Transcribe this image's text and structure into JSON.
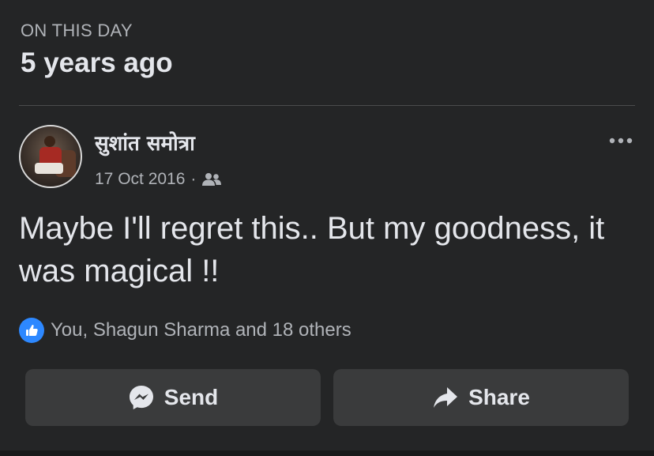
{
  "memory": {
    "label": "ON THIS DAY",
    "title": "5 years ago"
  },
  "post": {
    "author": "सुशांत समोत्रा",
    "date": "17 Oct 2016",
    "separator": "·",
    "audience_icon": "friends-icon",
    "more_icon": "more-options-icon",
    "text": "Maybe I'll regret this.. But my goodness, it was magical !!"
  },
  "reactions": {
    "icon": "like-icon",
    "summary": "You, Shagun Sharma and 18 others"
  },
  "actions": {
    "send": {
      "label": "Send",
      "icon": "messenger-icon"
    },
    "share": {
      "label": "Share",
      "icon": "share-arrow-icon"
    }
  },
  "colors": {
    "background": "#242526",
    "button_background": "#3a3b3c",
    "primary_text": "#e4e6eb",
    "secondary_text": "#b0b3b8",
    "like_blue": "#2d88ff"
  }
}
